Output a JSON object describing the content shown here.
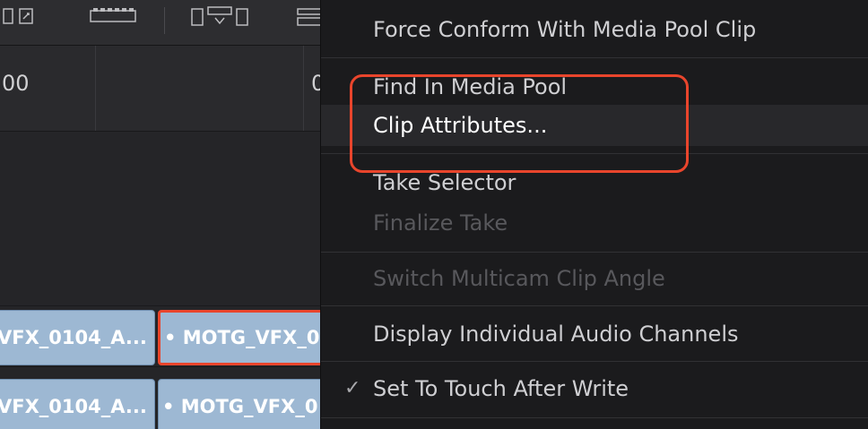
{
  "timeline": {
    "ruler_labels": [
      "00",
      "0"
    ],
    "clips_row1": [
      {
        "label": "VFX_0104_A...",
        "selected": false
      },
      {
        "label": "• MOTG_VFX_0",
        "selected": true
      }
    ],
    "clips_row2": [
      {
        "label": "VFX_0104_A...",
        "selected": false
      },
      {
        "label": "• MOTG_VFX_0",
        "selected": false
      }
    ]
  },
  "menu": {
    "items": [
      {
        "label": "Force Conform With Media Pool Clip",
        "enabled": true
      },
      {
        "label": "Find In Media Pool",
        "enabled": true
      },
      {
        "label": "Clip Attributes...",
        "enabled": true,
        "highlighted": true
      },
      {
        "label": "Take Selector",
        "enabled": true
      },
      {
        "label": "Finalize Take",
        "enabled": false
      },
      {
        "label": "Switch Multicam Clip Angle",
        "enabled": false
      },
      {
        "label": "Display Individual Audio Channels",
        "enabled": true
      },
      {
        "label": "Set To Touch After Write",
        "enabled": true,
        "checked": true
      }
    ],
    "check_mark": "✓"
  },
  "colors": {
    "annotation": "#e9452c",
    "clip_fill": "#9db8d3",
    "menu_bg": "#1b1b1d"
  }
}
